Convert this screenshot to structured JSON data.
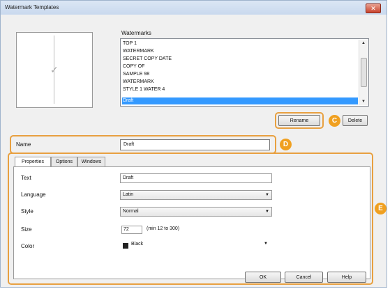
{
  "window": {
    "title": "Watermark Templates",
    "close_glyph": "✕"
  },
  "preview": {
    "check_glyph": "✓"
  },
  "list": {
    "label": "Watermarks",
    "items": [
      "TOP 1",
      "WATERMARK",
      "SECRET COPY DATE",
      "COPY OF",
      "SAMPLE 98",
      "WATERMARK",
      "STYLE 1 WATER 4",
      "Draft"
    ],
    "selected_index": 7
  },
  "buttons": {
    "rename": "Rename",
    "delete": "Delete",
    "ok": "OK",
    "cancel": "Cancel",
    "help": "Help"
  },
  "badges": {
    "rename": "C",
    "name": "D",
    "panel": "E"
  },
  "name_field": {
    "label": "Name",
    "value": "Draft"
  },
  "tabs": [
    "Properties",
    "Options",
    "Windows"
  ],
  "properties": {
    "text_label": "Text",
    "text_value": "Draft",
    "language_label": "Language",
    "language_value": "Latin",
    "style_label": "Style",
    "style_value": "Normal",
    "size_label": "Size",
    "size_value": "72",
    "size_range": "(min 12 to 300)",
    "color_label": "Color",
    "color_value": "Black"
  },
  "colors": {
    "highlight": "#e8a040",
    "selection": "#3399ff",
    "badge": "#f0a020"
  }
}
